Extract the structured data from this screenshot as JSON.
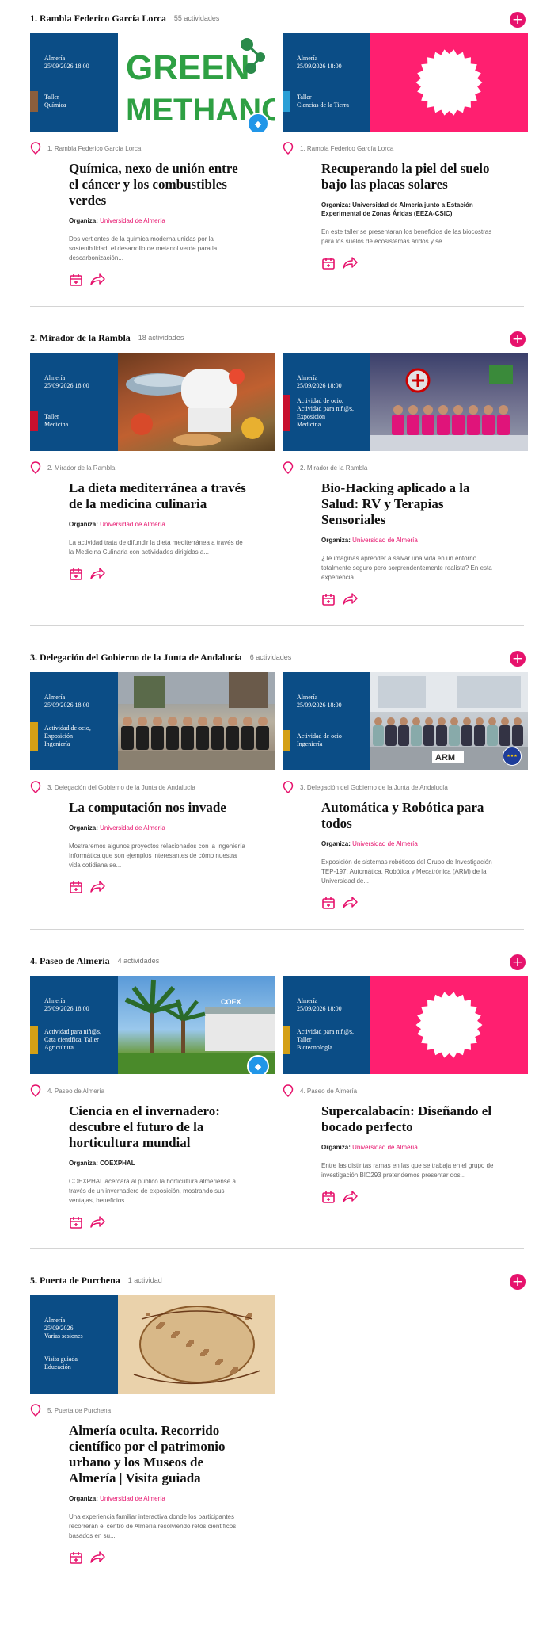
{
  "colors": {
    "brand_blue": "#0b4d86",
    "accent_pink": "#e6126c"
  },
  "sections": [
    {
      "title": "1. Rambla Federico García Lorca",
      "count": "55 actividades",
      "cards": [
        {
          "city": "Almería",
          "date": "25/09/2026 18:00",
          "extra": "",
          "cat1": "Taller",
          "cat2": "Química",
          "cat3": "",
          "cat4": "",
          "stripe": "#8b5e3c",
          "image_type": "green-methanol",
          "image_text1": "GREEN",
          "image_text2": "METHANOL",
          "location": "1. Rambla Federico García Lorca",
          "title": "Química, nexo de unión entre el cáncer y los combustibles verdes",
          "org_label": "Organiza:",
          "org_value": "Universidad de Almería",
          "org_pink": true,
          "desc": "Dos vertientes de la química moderna unidas por la sostenibilidad: el desarrollo de metanol verde para la descarbonización..."
        },
        {
          "city": "Almería",
          "date": "25/09/2026 18:00",
          "extra": "",
          "cat1": "Taller",
          "cat2": "Ciencias de la Tierra",
          "cat3": "",
          "cat4": "",
          "stripe": "#2a9fd6",
          "image_type": "pink-seal",
          "location": "1. Rambla Federico García Lorca",
          "title": "Recuperando la piel del suelo bajo las placas solares",
          "org_label": "Organiza:",
          "org_value": "Universidad de Almería junto a Estación Experimental de Zonas Áridas (EEZA-CSIC)",
          "org_pink": false,
          "desc": "En este taller se presentaran los beneficios de las biocostras para los suelos de ecosistemas áridos y se..."
        }
      ]
    },
    {
      "title": "2. Mirador de la Rambla",
      "count": "18 actividades",
      "cards": [
        {
          "city": "Almería",
          "date": "25/09/2026 18:00",
          "extra": "",
          "cat1": "Taller",
          "cat2": "Medicina",
          "cat3": "",
          "cat4": "",
          "stripe": "#c8102e",
          "image_type": "food",
          "location": "2. Mirador de la Rambla",
          "title": "La dieta mediterránea a través de la medicina culinaria",
          "org_label": "Organiza:",
          "org_value": "Universidad de Almería",
          "org_pink": true,
          "desc": "La actividad trata de difundir la dieta mediterránea a través de la Medicina Culinaria con actividades dirigidas a..."
        },
        {
          "city": "Almería",
          "date": "25/09/2026 18:00",
          "extra": "",
          "cat1": "Actividad de ocio,",
          "cat2": "Actividad para niñ@s,",
          "cat3": "Exposición",
          "cat4": "Medicina",
          "stripe": "#c8102e",
          "image_type": "group-pink",
          "location": "2. Mirador de la Rambla",
          "title": "Bio-Hacking aplicado a la Salud: RV y Terapias Sensoriales",
          "org_label": "Organiza:",
          "org_value": "Universidad de Almería",
          "org_pink": true,
          "desc": "¿Te imaginas aprender a salvar una vida en un entorno totalmente seguro pero sorprendentemente realista? En esta experiencia..."
        }
      ]
    },
    {
      "title": "3. Delegación del Gobierno de la Junta de Andalucía",
      "count": "6 actividades",
      "cards": [
        {
          "city": "Almería",
          "date": "25/09/2026 18:00",
          "extra": "",
          "cat1": "Actividad de ocio,",
          "cat2": "Exposición",
          "cat3": "Ingeniería",
          "cat4": "",
          "stripe": "#d4a017",
          "image_type": "group-outdoor",
          "location": "3. Delegación del Gobierno de la Junta de Andalucía",
          "title": "La computación nos invade",
          "org_label": "Organiza:",
          "org_value": "Universidad de Almería",
          "org_pink": true,
          "desc": "Mostraremos algunos proyectos relacionados con la Ingeniería Informática que son ejemplos interesantes de cómo nuestra vida cotidiana se..."
        },
        {
          "city": "Almería",
          "date": "25/09/2026 18:00",
          "extra": "",
          "cat1": "Actividad de ocio",
          "cat2": "Ingeniería",
          "cat3": "",
          "cat4": "",
          "stripe": "#d4a017",
          "image_type": "group-building",
          "image_text1": "ARM",
          "location": "3. Delegación del Gobierno de la Junta de Andalucía",
          "title": "Automática y Robótica para todos",
          "org_label": "Organiza:",
          "org_value": "Universidad de Almería",
          "org_pink": true,
          "desc": "Exposición de sistemas robóticos del Grupo de Investigación TEP-197: Automática, Robótica y Mecatrónica (ARM) de la Universidad de..."
        }
      ]
    },
    {
      "title": "4. Paseo de Almería",
      "count": "4 actividades",
      "cards": [
        {
          "city": "Almería",
          "date": "25/09/2026 18:00",
          "extra": "",
          "cat1": "Actividad para niñ@s,",
          "cat2": "Cata científica, Taller",
          "cat3": "Agricultura",
          "cat4": "",
          "stripe": "#d4a017",
          "image_type": "palms",
          "image_text1": "COEX",
          "location": "4. Paseo de Almería",
          "title": "Ciencia en el invernadero: descubre el futuro de la horticultura mundial",
          "org_label": "Organiza:",
          "org_value": "COEXPHAL",
          "org_pink": false,
          "desc": "COEXPHAL acercará al público la horticultura almeriense a través de un invernadero de exposición, mostrando sus ventajas, beneficios..."
        },
        {
          "city": "Almería",
          "date": "25/09/2026 18:00",
          "extra": "",
          "cat1": "Actividad para niñ@s,",
          "cat2": "Taller",
          "cat3": "Biotecnología",
          "cat4": "",
          "stripe": "#d4a017",
          "image_type": "pink-seal",
          "location": "4. Paseo de Almería",
          "title": "Supercalabacín: Diseñando el bocado perfecto",
          "org_label": "Organiza:",
          "org_value": "Universidad de Almería",
          "org_pink": true,
          "desc": "Entre las distintas ramas en las que se trabaja en el grupo de investigación BIO293 pretendemos presentar dos..."
        }
      ]
    },
    {
      "title": "5. Puerta de Purchena",
      "count": "1 actividad",
      "cards": [
        {
          "city": "Almería",
          "date": "25/09/2026",
          "extra": "Varias sesiones",
          "cat1": "Visita guiada",
          "cat2": "Educación",
          "cat3": "",
          "cat4": "",
          "stripe": "#0b4d86",
          "image_type": "map",
          "location": "5. Puerta de Purchena",
          "title": "Almería oculta. Recorrido científico por el patrimonio urbano y los Museos de Almería | Visita guiada",
          "org_label": "Organiza:",
          "org_value": "Universidad de Almería",
          "org_pink": true,
          "desc": "Una experiencia familiar interactiva donde los participantes recorrerán el centro de Almería resolviendo retos científicos basados en su..."
        }
      ]
    }
  ]
}
